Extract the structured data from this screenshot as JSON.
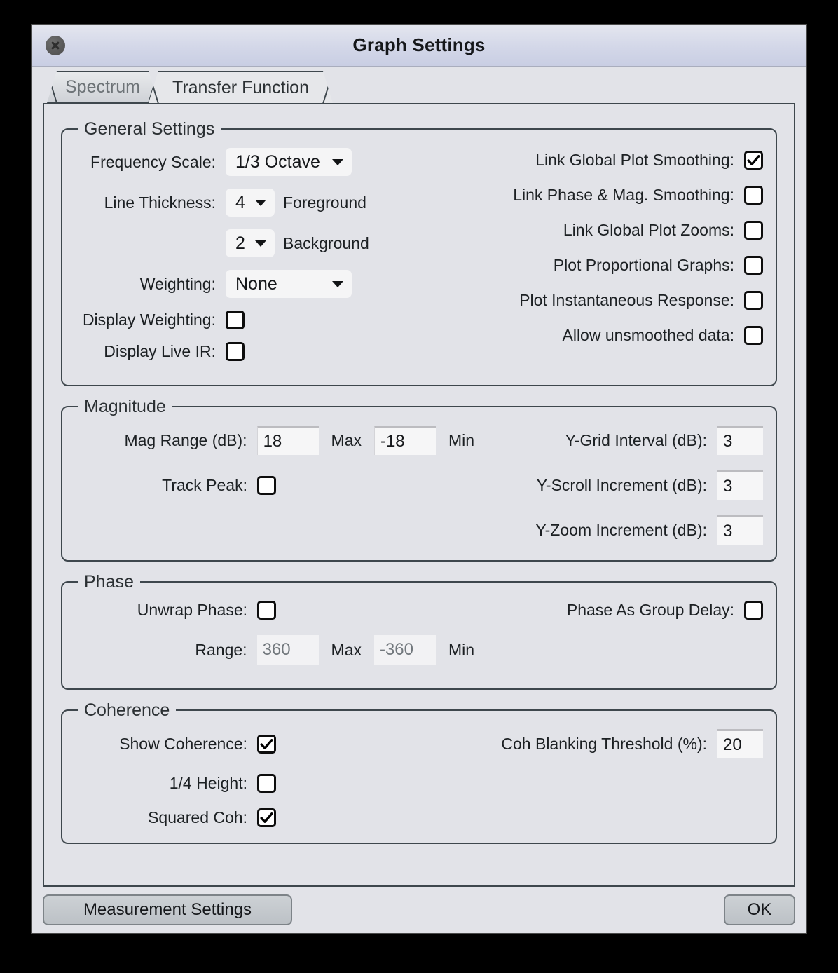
{
  "window": {
    "title": "Graph Settings",
    "close_icon": "close-icon"
  },
  "tabs": [
    {
      "label": "Spectrum",
      "active": false
    },
    {
      "label": "Transfer Function",
      "active": true
    }
  ],
  "general_settings": {
    "legend": "General Settings",
    "frequency_scale": {
      "label": "Frequency Scale:",
      "value": "1/3 Octave"
    },
    "line_thickness": {
      "label": "Line Thickness:",
      "foreground": {
        "value": "4",
        "suffix": "Foreground"
      },
      "background": {
        "value": "2",
        "suffix": "Background"
      }
    },
    "weighting": {
      "label": "Weighting:",
      "value": "None"
    },
    "display_weighting": {
      "label": "Display Weighting:",
      "checked": false
    },
    "display_live_ir": {
      "label": "Display Live IR:",
      "checked": false
    },
    "checkboxes": [
      {
        "label": "Link Global Plot Smoothing:",
        "checked": true
      },
      {
        "label": "Link Phase & Mag. Smoothing:",
        "checked": false
      },
      {
        "label": "Link Global Plot Zooms:",
        "checked": false
      },
      {
        "label": "Plot Proportional Graphs:",
        "checked": false
      },
      {
        "label": "Plot Instantaneous Response:",
        "checked": false
      },
      {
        "label": "Allow unsmoothed data:",
        "checked": false
      }
    ]
  },
  "magnitude": {
    "legend": "Magnitude",
    "mag_range": {
      "label": "Mag Range (dB):",
      "max_value": "18",
      "max_suffix": "Max",
      "min_value": "-18",
      "min_suffix": "Min"
    },
    "track_peak": {
      "label": "Track Peak:",
      "checked": false
    },
    "y_grid_interval": {
      "label": "Y-Grid Interval (dB):",
      "value": "3"
    },
    "y_scroll_increment": {
      "label": "Y-Scroll Increment (dB):",
      "value": "3"
    },
    "y_zoom_increment": {
      "label": "Y-Zoom Increment (dB):",
      "value": "3"
    }
  },
  "phase": {
    "legend": "Phase",
    "unwrap_phase": {
      "label": "Unwrap Phase:",
      "checked": false
    },
    "phase_as_group_delay": {
      "label": "Phase As Group Delay:",
      "checked": false
    },
    "range": {
      "label": "Range:",
      "max_value": "360",
      "max_suffix": "Max",
      "min_value": "-360",
      "min_suffix": "Min"
    }
  },
  "coherence": {
    "legend": "Coherence",
    "show_coherence": {
      "label": "Show Coherence:",
      "checked": true
    },
    "quarter_height": {
      "label": "1/4 Height:",
      "checked": false
    },
    "squared_coh": {
      "label": "Squared Coh:",
      "checked": true
    },
    "coh_blanking_threshold": {
      "label": "Coh Blanking Threshold (%):",
      "value": "20"
    }
  },
  "footer": {
    "measurement_settings": "Measurement Settings",
    "ok": "OK"
  },
  "colors": {
    "window_background": "#e2e3e8",
    "group_border": "#3e474d",
    "titlebar_top": "#e4e6ef",
    "titlebar_bottom": "#c9cee3",
    "field_background": "#f6f6f7",
    "button_face": "#c4c8cc"
  }
}
